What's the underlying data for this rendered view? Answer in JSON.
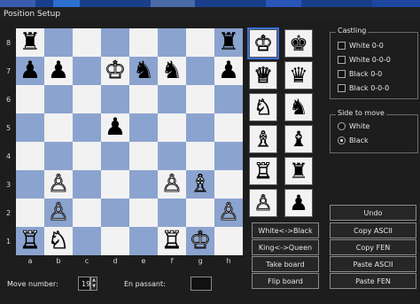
{
  "window": {
    "title": "Position Setup"
  },
  "board": {
    "ranks": [
      "8",
      "7",
      "6",
      "5",
      "4",
      "3",
      "2",
      "1"
    ],
    "files": [
      "a",
      "b",
      "c",
      "d",
      "e",
      "f",
      "g",
      "h"
    ],
    "light_color": "#f2f2f2",
    "dark_color": "#8ba3cf",
    "rows": [
      [
        "br",
        "",
        "",
        "",
        "",
        "",
        "",
        "br"
      ],
      [
        "bp",
        "bp",
        "",
        "wk",
        "bn",
        "bn",
        "",
        "bp"
      ],
      [
        "",
        "",
        "",
        "",
        "",
        "",
        "",
        ""
      ],
      [
        "",
        "",
        "",
        "bp",
        "",
        "",
        "",
        ""
      ],
      [
        "",
        "",
        "",
        "",
        "",
        "",
        "",
        ""
      ],
      [
        "",
        "wp",
        "",
        "",
        "",
        "wp",
        "wb",
        ""
      ],
      [
        "",
        "wp",
        "",
        "",
        "",
        "",
        "",
        "wp"
      ],
      [
        "wr",
        "wn",
        "",
        "",
        "",
        "wr",
        "wk",
        ""
      ]
    ]
  },
  "pieces": {
    "wk": "♔",
    "wq": "♕",
    "wr": "♖",
    "wb": "♗",
    "wn": "♘",
    "wp": "♙",
    "bk": "♚",
    "bq": "♛",
    "br": "♜",
    "bb": "♝",
    "bn": "♞",
    "bp": "♟"
  },
  "palette": {
    "white": [
      "wk",
      "wq",
      "wn",
      "wb",
      "wr",
      "wp"
    ],
    "black": [
      "bk",
      "bq",
      "bn",
      "bb",
      "br",
      "bp"
    ],
    "selected": "wk"
  },
  "castling": {
    "title": "Castling",
    "options": [
      {
        "label": "White 0-0",
        "checked": false
      },
      {
        "label": "White 0-0-0",
        "checked": false
      },
      {
        "label": "Black 0-0",
        "checked": false
      },
      {
        "label": "Black 0-0-0",
        "checked": false
      }
    ]
  },
  "side_to_move": {
    "title": "Side to move",
    "options": [
      {
        "label": "White",
        "selected": false
      },
      {
        "label": "Black",
        "selected": true
      }
    ]
  },
  "buttons": {
    "white_black": "White<->Black",
    "king_queen": "King<->Queen",
    "take_board": "Take board",
    "flip_board": "Flip board",
    "undo": "Undo",
    "copy_ascii": "Copy ASCII",
    "copy_fen": "Copy FEN",
    "paste_ascii": "Paste ASCII",
    "paste_fen": "Paste FEN"
  },
  "move_number": {
    "label": "Move number:",
    "value": "19"
  },
  "en_passant": {
    "label": "En passant:",
    "value": ""
  }
}
